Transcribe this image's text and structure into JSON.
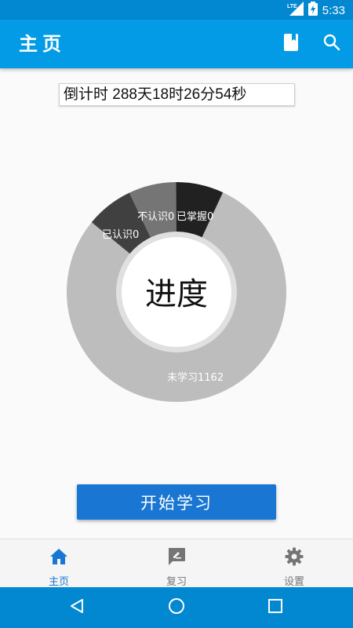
{
  "status_bar": {
    "network": "LTE",
    "time": "5:33"
  },
  "app_bar": {
    "title": "主页",
    "icons": [
      "book-icon",
      "search-icon"
    ]
  },
  "countdown": {
    "text": "倒计时  288天18时26分54秒"
  },
  "progress_chart": {
    "center_label": "进度",
    "colors": {
      "unlearned": "#bdbdbd",
      "recognized": "#404040",
      "unrecognized": "#757575",
      "mastered": "#212121"
    }
  },
  "chart_data": {
    "type": "pie",
    "title": "",
    "slices": [
      {
        "label": "未学习1162",
        "value": 1162,
        "display_fraction": 0.79
      },
      {
        "label": "已认识0",
        "value": 0,
        "display_fraction": 0.07
      },
      {
        "label": "不认识0",
        "value": 0,
        "display_fraction": 0.07
      },
      {
        "label": "已掌握0",
        "value": 0,
        "display_fraction": 0.07
      }
    ]
  },
  "start_button": {
    "label": "开始学习"
  },
  "bottom_nav": {
    "items": [
      {
        "label": "主页",
        "icon": "home-icon",
        "active": true
      },
      {
        "label": "复习",
        "icon": "review-icon",
        "active": false
      },
      {
        "label": "设置",
        "icon": "gear-icon",
        "active": false
      }
    ],
    "active_color": "#1976d2"
  },
  "system_nav": {
    "buttons": [
      "back-icon",
      "home-circle-icon",
      "recents-icon"
    ]
  }
}
